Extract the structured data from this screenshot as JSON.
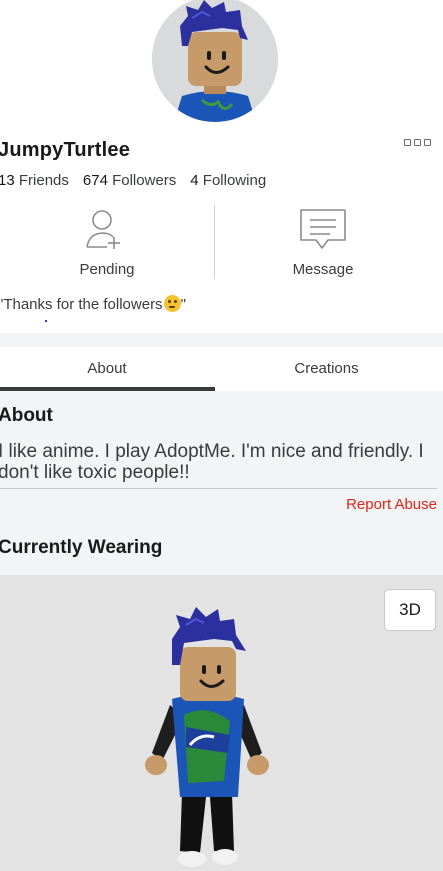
{
  "profile": {
    "username": "JumpyTurtlee",
    "stats": {
      "friends_count": "13",
      "friends_label": "Friends",
      "followers_count": "674",
      "followers_label": "Followers",
      "following_count": "4",
      "following_label": "Following"
    },
    "actions": {
      "pending_label": "Pending",
      "message_label": "Message"
    },
    "status_open": "\"Thanks for the followers",
    "status_close": "\""
  },
  "tabs": [
    {
      "label": "About",
      "active": true
    },
    {
      "label": "Creations",
      "active": false
    }
  ],
  "about": {
    "title": "About",
    "description": "I like anime. I play AdoptMe. I'm nice and friendly. I don't like toxic people!!",
    "report_label": "Report Abuse"
  },
  "wearing": {
    "title": "Currently Wearing",
    "view_toggle_label": "3D"
  },
  "icons": {
    "more": "more-options-icon",
    "pending": "add-friend-icon",
    "message": "message-icon",
    "emoji": "thinking-face-icon"
  },
  "colors": {
    "report": "#e2231a",
    "avatar_hair": "#2c2f9e",
    "avatar_skin": "#c79a6a",
    "shirt": "#1c55b8"
  }
}
